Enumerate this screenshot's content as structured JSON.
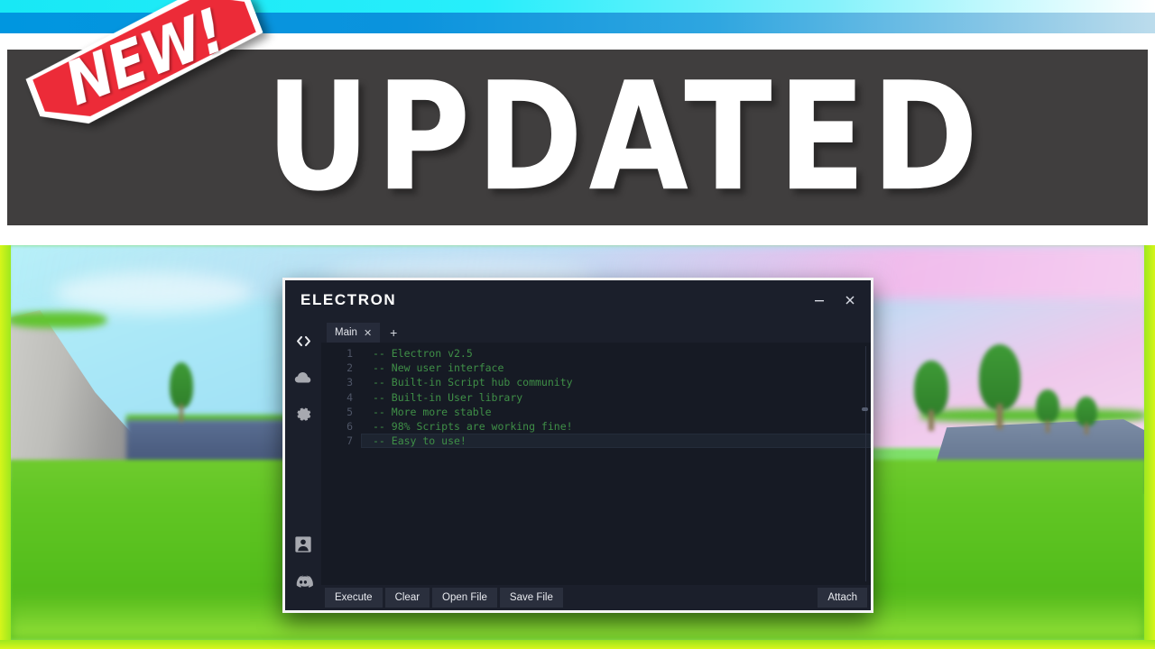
{
  "thumbnail": {
    "headline": "UPDATED",
    "badge_label": "NEW!",
    "banner_color": "#403e3e",
    "badge_color": "#ec2b38",
    "top_strip_color": "#18e8f5",
    "top_band_color": "#0096e0",
    "frame_edge_color": "#9ee81e"
  },
  "scene": {
    "description": "blurred roblox landscape: cliff, trees, grass",
    "sky_color": "#a9e7f7",
    "grass_color": "#62c624",
    "rock_color": "#4d5f82"
  },
  "window": {
    "title": "ELECTRON",
    "controls": {
      "minimize": "minimize-icon",
      "close": "close-icon"
    },
    "sidebar": [
      {
        "name": "code-brackets-icon",
        "label": "Editor"
      },
      {
        "name": "cloud-icon",
        "label": "Script Hub"
      },
      {
        "name": "gear-icon",
        "label": "Settings"
      },
      {
        "name": "user-icon",
        "label": "User Library"
      },
      {
        "name": "discord-icon",
        "label": "Discord"
      }
    ],
    "tabs": [
      {
        "label": "Main",
        "close": "✕",
        "active": true
      }
    ],
    "tab_add_label": "+",
    "editor": {
      "language": "lua",
      "line_numbers": [
        "1",
        "2",
        "3",
        "4",
        "5",
        "6",
        "7"
      ],
      "lines": [
        "-- Electron v2.5",
        "-- New user interface",
        "-- Built-in Script hub community",
        "-- Built-in User library",
        "-- More more stable",
        "-- 98% Scripts are working fine!",
        "-- Easy to use!"
      ],
      "active_line": 7,
      "comment_color": "#3f8f47",
      "background": "#161a24"
    },
    "buttons": {
      "execute": "Execute",
      "clear": "Clear",
      "open_file": "Open File",
      "save_file": "Save File",
      "attach": "Attach"
    }
  }
}
